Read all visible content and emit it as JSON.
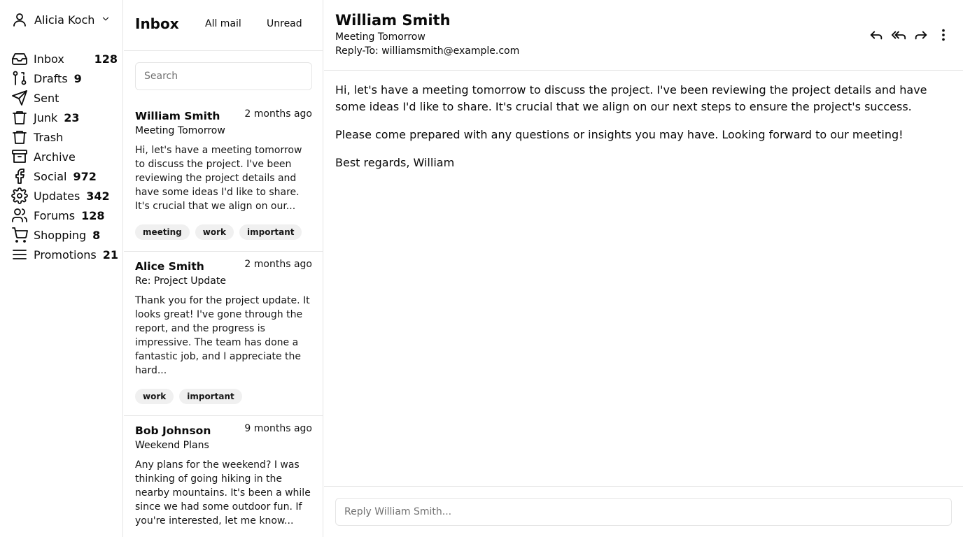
{
  "account": {
    "name": "Alicia Koch"
  },
  "nav": [
    {
      "label": "Inbox",
      "count": "128",
      "icon": "inbox-icon"
    },
    {
      "label": "Drafts",
      "count": "9",
      "icon": "drafts-icon"
    },
    {
      "label": "Sent",
      "count": "",
      "icon": "send-icon"
    },
    {
      "label": "Junk",
      "count": "23",
      "icon": "trash-icon"
    },
    {
      "label": "Trash",
      "count": "",
      "icon": "trash-icon"
    },
    {
      "label": "Archive",
      "count": "",
      "icon": "archive-icon"
    },
    {
      "label": "Social",
      "count": "972",
      "icon": "facebook-icon"
    },
    {
      "label": "Updates",
      "count": "342",
      "icon": "gear-icon"
    },
    {
      "label": "Forums",
      "count": "128",
      "icon": "users-icon"
    },
    {
      "label": "Shopping",
      "count": "8",
      "icon": "cart-icon"
    },
    {
      "label": "Promotions",
      "count": "21",
      "icon": "menu-icon"
    }
  ],
  "list": {
    "title": "Inbox",
    "tabs": [
      "All mail",
      "Unread"
    ],
    "search_placeholder": "Search",
    "mails": [
      {
        "from": "William Smith",
        "date": "2 months ago",
        "subject": "Meeting Tomorrow",
        "preview": "Hi, let's have a meeting tomorrow to discuss the project. I've been reviewing the project details and have some ideas I'd like to share. It's crucial that we align on our...",
        "tags": [
          "meeting",
          "work",
          "important"
        ]
      },
      {
        "from": "Alice Smith",
        "date": "2 months ago",
        "subject": "Re: Project Update",
        "preview": "Thank you for the project update. It looks great! I've gone through the report, and the progress is impressive. The team has done a fantastic job, and I appreciate the hard...",
        "tags": [
          "work",
          "important"
        ]
      },
      {
        "from": "Bob Johnson",
        "date": "9 months ago",
        "subject": "Weekend Plans",
        "preview": "Any plans for the weekend? I was thinking of going hiking in the nearby mountains. It's been a while since we had some outdoor fun. If you're interested, let me know...",
        "tags": []
      }
    ]
  },
  "message": {
    "sender": "William Smith",
    "subject": "Meeting Tomorrow",
    "reply_to": "Reply-To: williamsmith@example.com",
    "paragraphs": [
      "Hi, let's have a meeting tomorrow to discuss the project. I've been reviewing the project details and have some ideas I'd like to share. It's crucial that we align on our next steps to ensure the project's success.",
      "Please come prepared with any questions or insights you may have. Looking forward to our meeting!",
      "Best regards, William"
    ],
    "actions": [
      "reply-icon",
      "reply-all-icon",
      "forward-icon",
      "more-vertical-icon"
    ],
    "reply_placeholder": "Reply William Smith..."
  }
}
